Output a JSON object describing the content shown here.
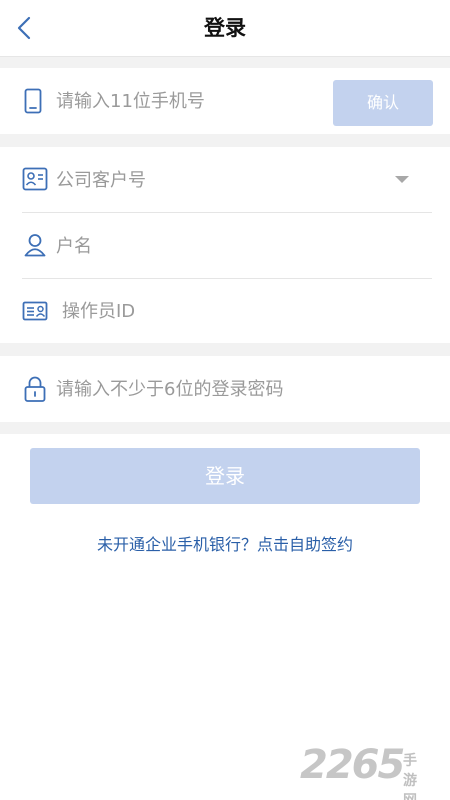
{
  "header": {
    "title": "登录"
  },
  "phone": {
    "placeholder": "请输入11位手机号",
    "value": "",
    "confirm_label": "确认"
  },
  "company": {
    "placeholder": "公司客户号",
    "value": ""
  },
  "username": {
    "placeholder": "户名",
    "value": ""
  },
  "operator": {
    "placeholder": "操作员ID",
    "value": ""
  },
  "password": {
    "placeholder": "请输入不少于6位的登录密码",
    "value": ""
  },
  "login_label": "登录",
  "signup_link": "未开通企业手机银行？点击自助签约",
  "watermark": {
    "number": "2265",
    "text": "手游网"
  },
  "colors": {
    "accent": "#2a5fa8",
    "button_disabled": "#c3d2ee",
    "icon": "#3d6fb6",
    "separator": "#f2f2f2"
  },
  "icons": [
    "chevron-left-icon",
    "phone-icon",
    "id-card-icon",
    "user-icon",
    "badge-icon",
    "lock-icon",
    "caret-down-icon"
  ]
}
